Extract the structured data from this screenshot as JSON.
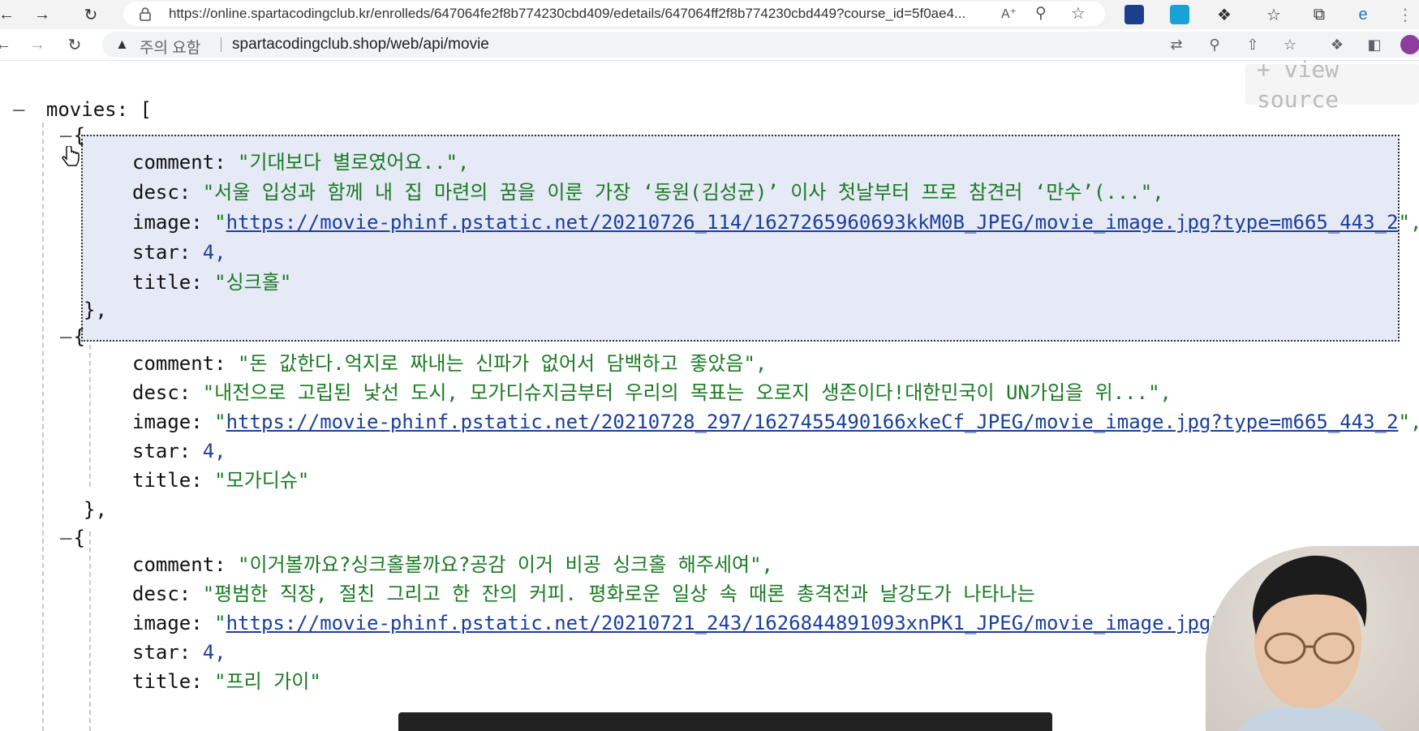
{
  "outer_browser": {
    "url": "https://online.spartacodingclub.kr/enrolleds/647064fe2f8b774230cbd409/edetails/647064ff2f8b774230cbd449?course_id=5f0ae4..."
  },
  "inner_browser": {
    "security_warning": "주의 요함",
    "url": "spartacodingclub.shop/web/api/movie"
  },
  "view_source_button": "+ view source",
  "json_viewer": {
    "root_key": "movies",
    "movies": [
      {
        "comment": "\"기대보다 별로였어요..\",",
        "desc": "\"서울 입성과 함께 내 집 마련의 꿈을 이룬 가장 ‘동원(김성균)’ 이사 첫날부터 프로 참견러 ‘만수’(...\",",
        "image": "https://movie-phinf.pstatic.net/20210726_114/1627265960693kkM0B_JPEG/movie_image.jpg?type=m665_443_2",
        "star": "4,",
        "title": "\"싱크홀\""
      },
      {
        "comment": "\"돈 값한다.억지로 짜내는 신파가 없어서 담백하고 좋았음\",",
        "desc": "\"내전으로 고립된 낯선 도시, 모가디슈지금부터 우리의 목표는 오로지 생존이다!대한민국이 UN가입을 위...\",",
        "image": "https://movie-phinf.pstatic.net/20210728_297/1627455490166xkeCf_JPEG/movie_image.jpg?type=m665_443_2",
        "star": "4,",
        "title": "\"모가디슈\""
      },
      {
        "comment": "\"이거볼까요?싱크홀볼까요?공감 이거 비공 싱크홀 해주세여\",",
        "desc": "\"평범한 직장, 절친 그리고 한 잔의 커피. 평화로운 일상 속 때론 총격전과 날강도가 나타나는",
        "image": "https://movie-phinf.pstatic.net/20210721_243/1626844891093xnPK1_JPEG/movie_image.jpg?",
        "star": "4,",
        "title": "\"프리 가이\""
      }
    ]
  }
}
